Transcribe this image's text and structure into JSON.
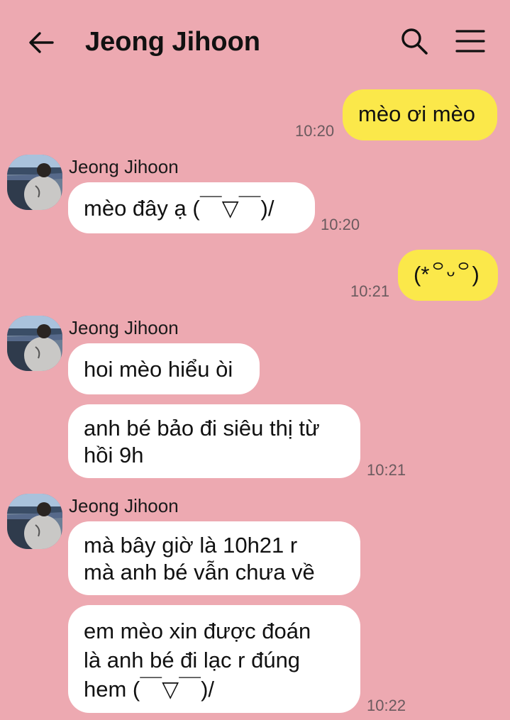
{
  "header": {
    "title": "Jeong Jihoon",
    "back_icon": "arrow-left-icon",
    "search_icon": "search-icon",
    "menu_icon": "hamburger-menu-icon"
  },
  "colors": {
    "background": "#EDA9B1",
    "outgoing_bubble": "#FBE84A",
    "incoming_bubble": "#FFFFFF"
  },
  "messages": [
    {
      "direction": "out",
      "text": "mèo ơi mèo",
      "time": "10:20"
    },
    {
      "direction": "in",
      "sender": "Jeong Jihoon",
      "text": "mèo đây ạ (￣▽￣)/",
      "time": "10:20"
    },
    {
      "direction": "out",
      "text": "(*꒪ᵕ꒪)",
      "time": "10:21"
    },
    {
      "direction": "in",
      "sender": "Jeong Jihoon",
      "text": "hoi mèo hiểu òi"
    },
    {
      "direction": "in",
      "text_lines": [
        "anh bé bảo đi siêu thị từ",
        "hồi 9h"
      ],
      "time": "10:21"
    },
    {
      "direction": "in",
      "sender": "Jeong Jihoon",
      "text_lines": [
        "mà bây giờ là 10h21 r",
        "mà anh bé vẫn chưa về"
      ]
    },
    {
      "direction": "in",
      "text_lines": [
        "em mèo xin được đoán",
        "là anh bé đi lạc r đúng",
        "hem (￣▽￣)/"
      ],
      "time": "10:22"
    }
  ]
}
